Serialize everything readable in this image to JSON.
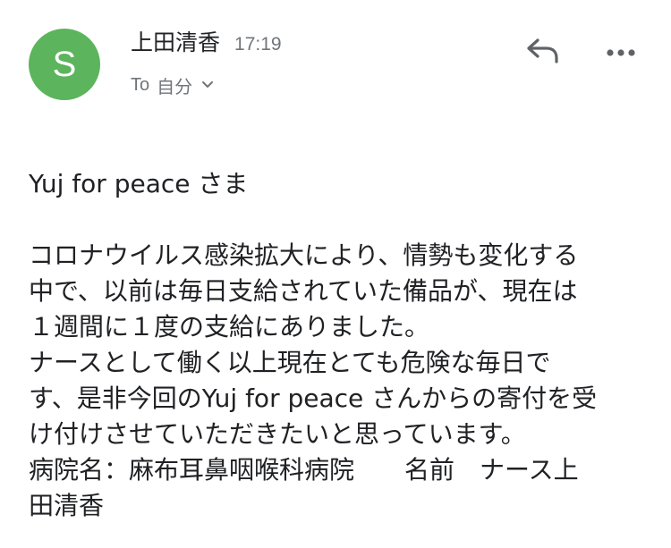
{
  "email": {
    "sender": {
      "avatar_letter": "S",
      "avatar_color": "#5cb45d",
      "name": "上田清香",
      "time": "17:19"
    },
    "recipient": {
      "to_label": "To",
      "name": "自分",
      "chevron_icon": "chevron-down-icon"
    },
    "actions": {
      "reply_icon": "reply-icon",
      "more_icon": "more-horiz-icon"
    },
    "body": {
      "greeting": "Yuj for peace さま",
      "lines": [
        "コロナウイルス感染拡大により、情勢も変化する",
        "中で、以前は毎日支給されていた備品が、現在は",
        "１週間に１度の支給にありました。",
        "ナースとして働く以上現在とても危険な毎日で",
        "す、是非今回のYuj for peace さんからの寄付を受",
        "け付けさせていただきたいと思っています。",
        "病院名：麻布耳鼻咽喉科病院　　名前　ナース上",
        "田清香"
      ]
    }
  }
}
